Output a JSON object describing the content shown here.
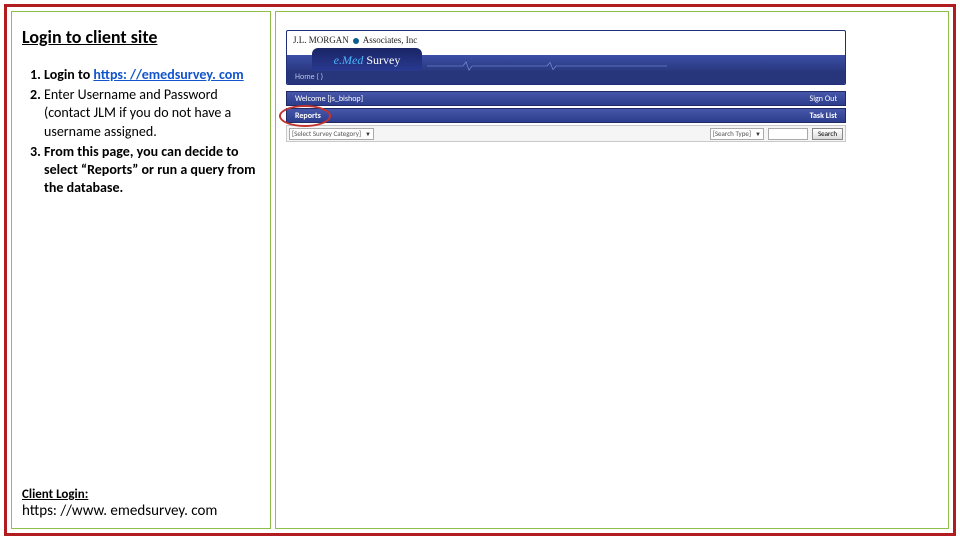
{
  "left": {
    "title": "Login to client site",
    "step1_prefix": "Login to ",
    "step1_link": "https: //emedsurvey. com",
    "step2": "Enter Username and Password (contact JLM if you do not have a username assigned.",
    "step3": "From this page, you can decide to select “Reports” or run a query from the database.",
    "footer_label": "Client Login:",
    "footer_url": "https: //www. emedsurvey. com"
  },
  "shot": {
    "logo_text_a": "J.L. MORGAN",
    "logo_text_b": "Associates, Inc",
    "tab_emed": "e.Med",
    "tab_survey": " Survey",
    "home": "Home ( )",
    "welcome": "Welcome  [js_bishop]",
    "signout": "Sign Out",
    "reports": "Reports",
    "tasklist": "Task List",
    "select_category": "[Select Survey Category]",
    "search_type": "[Search Type]",
    "search_btn": "Search"
  }
}
